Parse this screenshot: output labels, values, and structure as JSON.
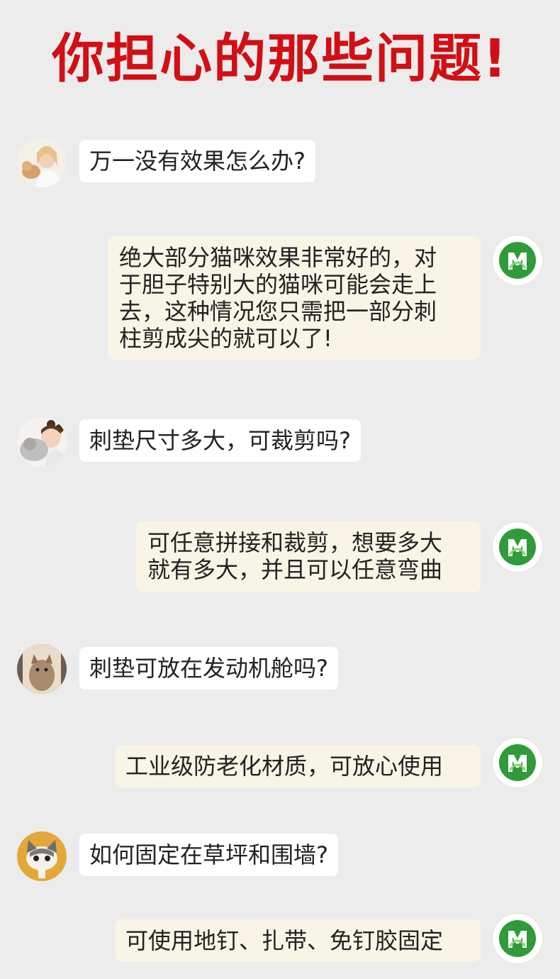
{
  "title": "你担心的那些问题!",
  "colors": {
    "title": "#d10f15",
    "background": "#ececec",
    "answer_bubble": "#f8f4e6",
    "question_bubble": "#ffffff",
    "logo_green": "#2f9b3a"
  },
  "conversation": [
    {
      "question": "万一没有效果怎么办?",
      "avatar_icon": "woman-with-cat-avatar",
      "answer_lines": [
        "绝大部分猫咪效果非常好的，对",
        "于胆子特别大的猫咪可能会走上",
        "去，这种情况您只需把一部分刺",
        "柱剪成尖的就可以了!"
      ]
    },
    {
      "question": "刺垫尺寸多大，可裁剪吗?",
      "avatar_icon": "girl-with-cat-avatar",
      "answer_lines": [
        "可任意拼接和裁剪，想要多大",
        "就有多大，并且可以任意弯曲"
      ]
    },
    {
      "question": "刺垫可放在发动机舱吗?",
      "avatar_icon": "kitten-avatar",
      "answer_lines": [
        "工业级防老化材质，可放心使用"
      ]
    },
    {
      "question": "如何固定在草坪和围墙?",
      "avatar_icon": "cartoon-cat-avatar",
      "answer_lines": [
        "可使用地钉、扎带、免钉胶固定"
      ]
    }
  ],
  "brand_icon": "green-m-logo-icon"
}
